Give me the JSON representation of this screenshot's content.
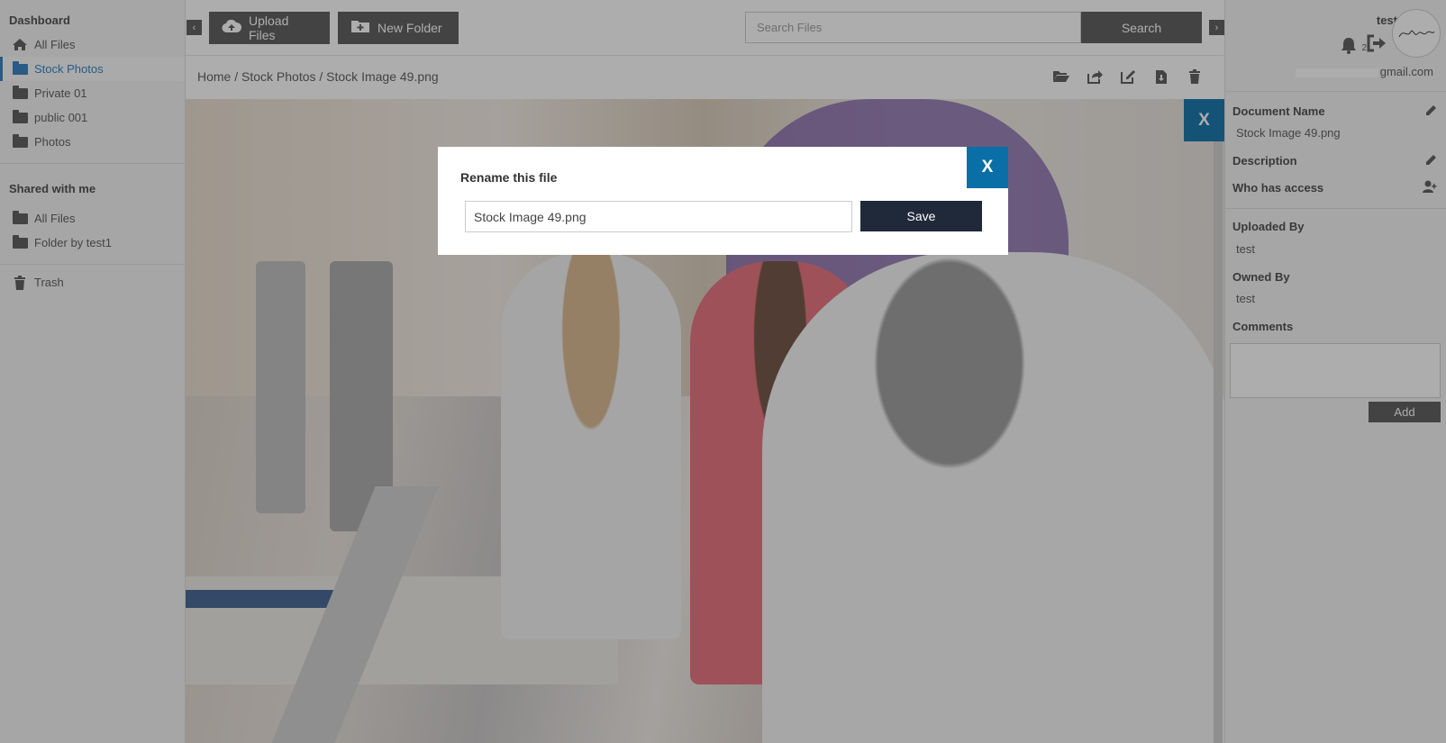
{
  "sidebar": {
    "dashboard_heading": "Dashboard",
    "my_items": [
      {
        "label": "All Files",
        "icon": "home-icon"
      },
      {
        "label": "Stock Photos",
        "icon": "folder-icon",
        "active": true
      },
      {
        "label": "Private 01",
        "icon": "folder-icon"
      },
      {
        "label": "public 001",
        "icon": "folder-icon"
      },
      {
        "label": "Photos",
        "icon": "folder-icon"
      }
    ],
    "shared_heading": "Shared with me",
    "shared_items": [
      {
        "label": "All Files",
        "icon": "folder-icon"
      },
      {
        "label": "Folder by test1",
        "icon": "folder-icon"
      }
    ],
    "trash_label": "Trash"
  },
  "toolbar": {
    "upload_label": "Upload Files",
    "new_folder_label": "New Folder",
    "search_placeholder": "Search Files",
    "search_label": "Search",
    "collapse_left_glyph": "‹",
    "collapse_right_glyph": "›"
  },
  "breadcrumb": {
    "text": "Home / Stock Photos / Stock Image 49.png"
  },
  "actions": [
    "open-folder-icon",
    "share-icon",
    "edit-icon",
    "download-icon",
    "trash-icon"
  ],
  "viewer": {
    "close_label": "X"
  },
  "user": {
    "name": "test",
    "notification_count": "2",
    "email_visible": "gmail.com"
  },
  "details": {
    "document_name_label": "Document Name",
    "document_name_value": "Stock Image 49.png",
    "description_label": "Description",
    "who_has_access_label": "Who has access",
    "uploaded_by_label": "Uploaded By",
    "uploaded_by_value": "test",
    "owned_by_label": "Owned By",
    "owned_by_value": "test",
    "comments_label": "Comments",
    "add_label": "Add"
  },
  "modal": {
    "title": "Rename this file",
    "close_label": "X",
    "input_value": "Stock Image 49.png",
    "save_label": "Save"
  },
  "colors": {
    "accent": "#0a6fa6",
    "save_button": "#20293a",
    "active_link": "#2a7bbf"
  }
}
